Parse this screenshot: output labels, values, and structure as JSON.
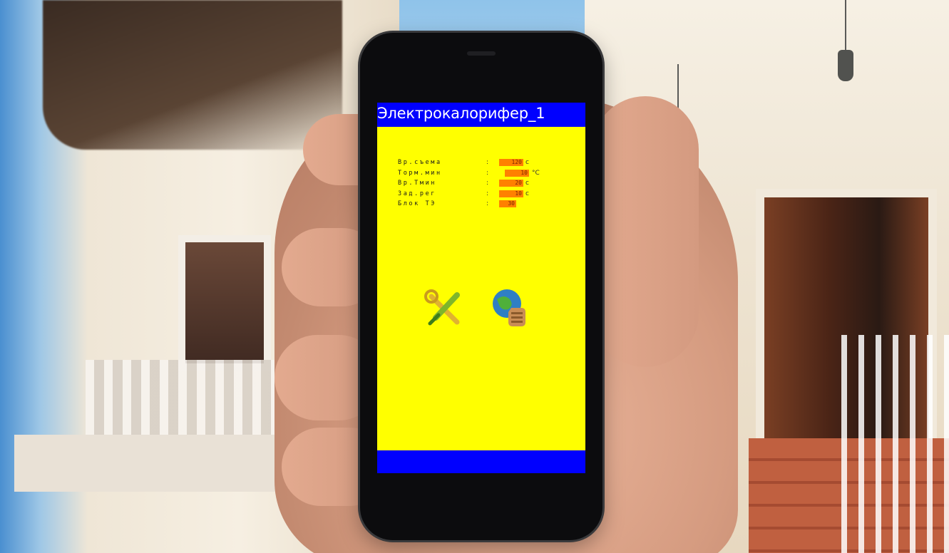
{
  "app": {
    "title": "Электрокалорифер_1"
  },
  "params": [
    {
      "label": "Вр.съема",
      "value": "120",
      "unit": "с"
    },
    {
      "label": "Торм.мин",
      "value": "10",
      "unit": "°С"
    },
    {
      "label": "Вр.Тмин",
      "value": "20",
      "unit": "с"
    },
    {
      "label": "Зад.рег",
      "value": "10",
      "unit": "с"
    },
    {
      "label": "Блок ТЭ",
      "value": "30",
      "unit": ""
    }
  ],
  "icons": {
    "settings": "tools-icon",
    "remote": "remote-control-icon"
  },
  "colors": {
    "screen_bg": "#ffff00",
    "title_bar": "#0000ff",
    "value_field": "#ff8000"
  }
}
